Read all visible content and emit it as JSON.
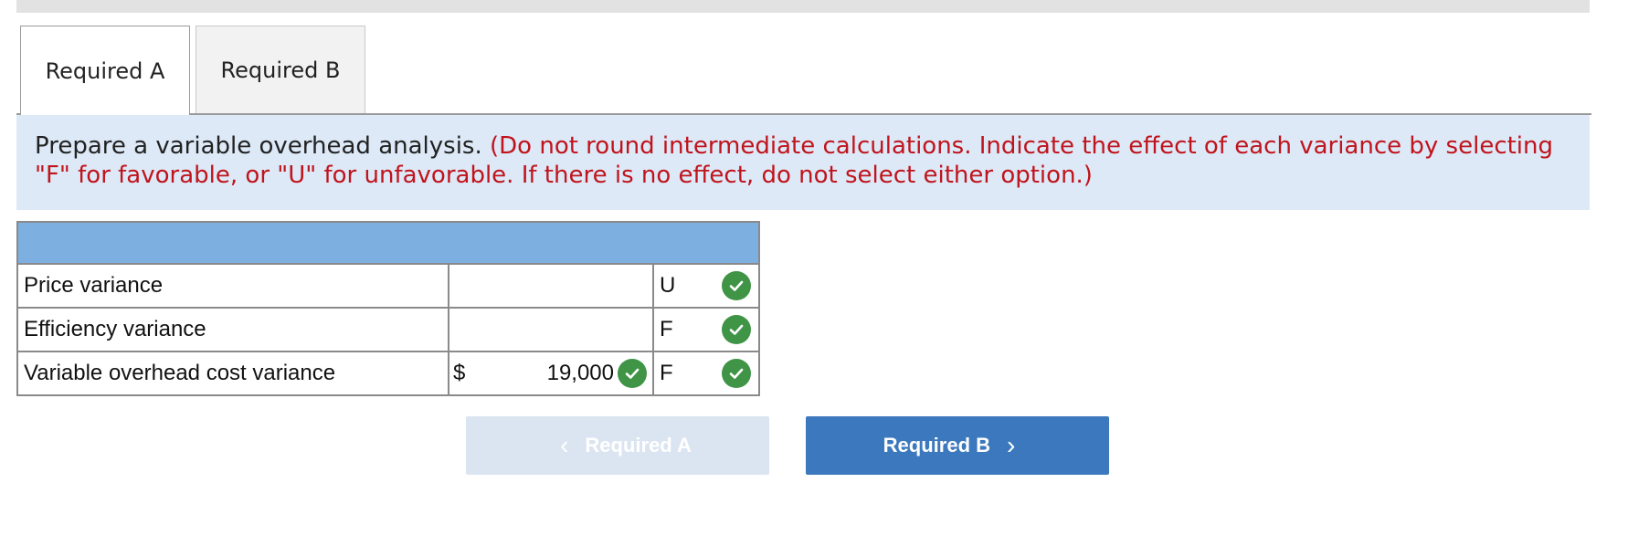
{
  "tabs": [
    {
      "label": "Required A",
      "active": true
    },
    {
      "label": "Required B",
      "active": false
    }
  ],
  "instructions": {
    "main": "Prepare a variable overhead analysis.",
    "note": "(Do not round intermediate calculations. Indicate the effect of each variance by selecting \"F\" for favorable, or \"U\" for unfavorable. If there is no effect, do not select either option.)"
  },
  "table": {
    "rows": [
      {
        "label": "Price variance",
        "currency": "",
        "amount": "",
        "effect": "U"
      },
      {
        "label": "Efficiency variance",
        "currency": "",
        "amount": "",
        "effect": "F"
      },
      {
        "label": "Variable overhead cost variance",
        "currency": "$",
        "amount": "19,000",
        "effect": "F"
      }
    ]
  },
  "nav": {
    "prev_label": "Required A",
    "prev_icon": "chevron-left-icon",
    "next_label": "Required B",
    "next_icon": "chevron-right-icon"
  },
  "colors": {
    "instructions_bg": "#dde9f7",
    "note_text": "#c0141c",
    "table_header": "#7dafe1",
    "check_green": "#3f9446",
    "next_button": "#3c78bd",
    "prev_button_disabled": "#dbe5f1"
  }
}
